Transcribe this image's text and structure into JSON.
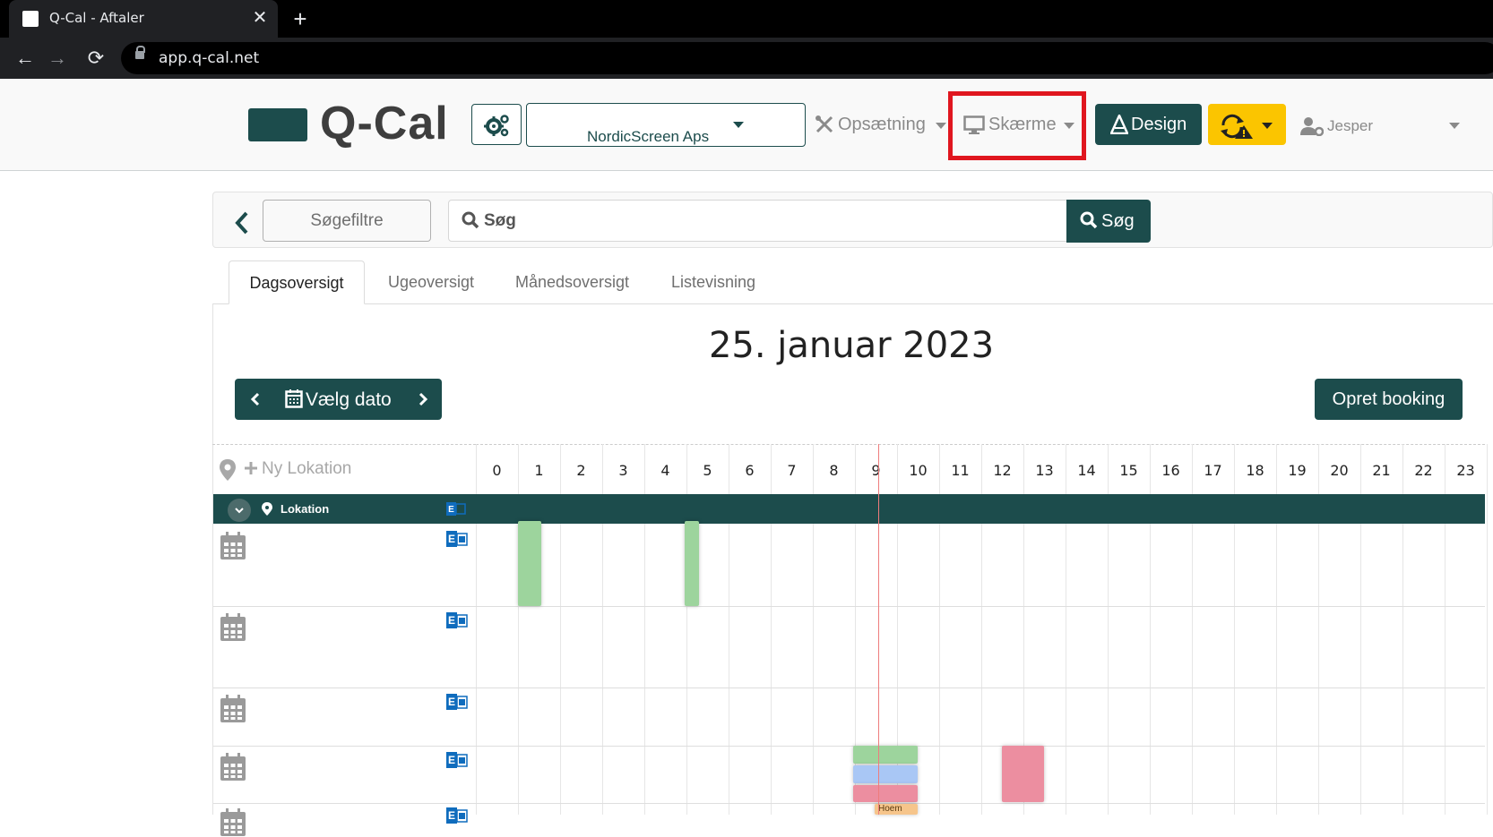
{
  "browser": {
    "tab_title": "Q-Cal - Aftaler",
    "close_glyph": "✕",
    "new_tab_glyph": "+",
    "url": "app.q-cal.net",
    "nav": {
      "back": "←",
      "forward": "→",
      "reload": "⟳"
    }
  },
  "header": {
    "logo_text": "Q-Cal",
    "company": "NordicScreen Aps",
    "menu_setup": "Opsætning",
    "menu_screens": "Skærme",
    "design_button": "Design",
    "user_name": "Jesper",
    "brand_color": "#1c4c4c",
    "warning_color": "#fbc500",
    "highlight_color": "#e0161f"
  },
  "search": {
    "filters_button": "Søgefiltre",
    "placeholder": "Søg",
    "button": "Søg"
  },
  "tabs": [
    {
      "label": "Dagsoversigt",
      "active": true
    },
    {
      "label": "Ugeoversigt",
      "active": false
    },
    {
      "label": "Månedsoversigt",
      "active": false
    },
    {
      "label": "Listevisning",
      "active": false
    }
  ],
  "calendar": {
    "date_title": "25. januar 2023",
    "pick_date": "Vælg dato",
    "create_booking": "Opret booking",
    "new_location": "Ny Lokation",
    "hours": [
      "0",
      "1",
      "2",
      "3",
      "4",
      "5",
      "6",
      "7",
      "8",
      "9",
      "10",
      "11",
      "12",
      "13",
      "14",
      "15",
      "16",
      "17",
      "18",
      "19",
      "20",
      "21",
      "22",
      "23"
    ],
    "group_label": "Lokation",
    "current_time_hour": 9.1,
    "event_colors": {
      "green": "#9dd49d",
      "blue": "#a9c7f5",
      "red": "#ec8ea0",
      "orange": "#f6c58b"
    },
    "event_label_partial": "Hoem"
  }
}
